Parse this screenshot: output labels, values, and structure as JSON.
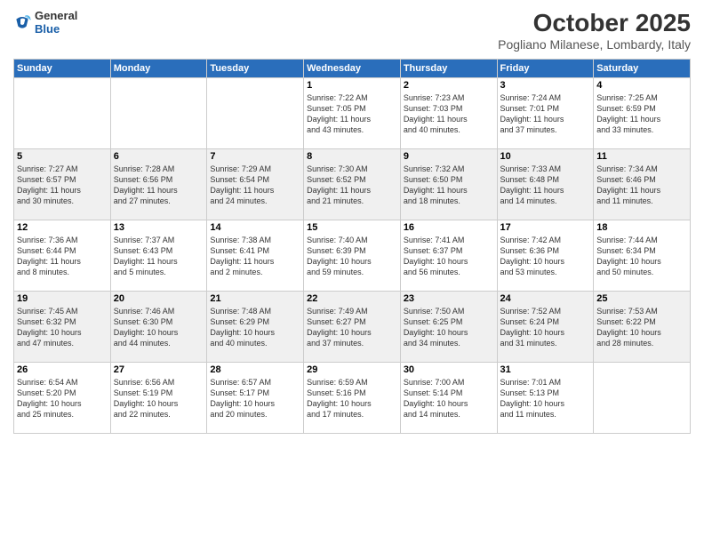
{
  "header": {
    "logo_general": "General",
    "logo_blue": "Blue",
    "month_title": "October 2025",
    "location": "Pogliano Milanese, Lombardy, Italy"
  },
  "weekdays": [
    "Sunday",
    "Monday",
    "Tuesday",
    "Wednesday",
    "Thursday",
    "Friday",
    "Saturday"
  ],
  "rows": [
    {
      "shade": "white",
      "cells": [
        {
          "day": "",
          "info": ""
        },
        {
          "day": "",
          "info": ""
        },
        {
          "day": "",
          "info": ""
        },
        {
          "day": "1",
          "info": "Sunrise: 7:22 AM\nSunset: 7:05 PM\nDaylight: 11 hours\nand 43 minutes."
        },
        {
          "day": "2",
          "info": "Sunrise: 7:23 AM\nSunset: 7:03 PM\nDaylight: 11 hours\nand 40 minutes."
        },
        {
          "day": "3",
          "info": "Sunrise: 7:24 AM\nSunset: 7:01 PM\nDaylight: 11 hours\nand 37 minutes."
        },
        {
          "day": "4",
          "info": "Sunrise: 7:25 AM\nSunset: 6:59 PM\nDaylight: 11 hours\nand 33 minutes."
        }
      ]
    },
    {
      "shade": "shaded",
      "cells": [
        {
          "day": "5",
          "info": "Sunrise: 7:27 AM\nSunset: 6:57 PM\nDaylight: 11 hours\nand 30 minutes."
        },
        {
          "day": "6",
          "info": "Sunrise: 7:28 AM\nSunset: 6:56 PM\nDaylight: 11 hours\nand 27 minutes."
        },
        {
          "day": "7",
          "info": "Sunrise: 7:29 AM\nSunset: 6:54 PM\nDaylight: 11 hours\nand 24 minutes."
        },
        {
          "day": "8",
          "info": "Sunrise: 7:30 AM\nSunset: 6:52 PM\nDaylight: 11 hours\nand 21 minutes."
        },
        {
          "day": "9",
          "info": "Sunrise: 7:32 AM\nSunset: 6:50 PM\nDaylight: 11 hours\nand 18 minutes."
        },
        {
          "day": "10",
          "info": "Sunrise: 7:33 AM\nSunset: 6:48 PM\nDaylight: 11 hours\nand 14 minutes."
        },
        {
          "day": "11",
          "info": "Sunrise: 7:34 AM\nSunset: 6:46 PM\nDaylight: 11 hours\nand 11 minutes."
        }
      ]
    },
    {
      "shade": "white",
      "cells": [
        {
          "day": "12",
          "info": "Sunrise: 7:36 AM\nSunset: 6:44 PM\nDaylight: 11 hours\nand 8 minutes."
        },
        {
          "day": "13",
          "info": "Sunrise: 7:37 AM\nSunset: 6:43 PM\nDaylight: 11 hours\nand 5 minutes."
        },
        {
          "day": "14",
          "info": "Sunrise: 7:38 AM\nSunset: 6:41 PM\nDaylight: 11 hours\nand 2 minutes."
        },
        {
          "day": "15",
          "info": "Sunrise: 7:40 AM\nSunset: 6:39 PM\nDaylight: 10 hours\nand 59 minutes."
        },
        {
          "day": "16",
          "info": "Sunrise: 7:41 AM\nSunset: 6:37 PM\nDaylight: 10 hours\nand 56 minutes."
        },
        {
          "day": "17",
          "info": "Sunrise: 7:42 AM\nSunset: 6:36 PM\nDaylight: 10 hours\nand 53 minutes."
        },
        {
          "day": "18",
          "info": "Sunrise: 7:44 AM\nSunset: 6:34 PM\nDaylight: 10 hours\nand 50 minutes."
        }
      ]
    },
    {
      "shade": "shaded",
      "cells": [
        {
          "day": "19",
          "info": "Sunrise: 7:45 AM\nSunset: 6:32 PM\nDaylight: 10 hours\nand 47 minutes."
        },
        {
          "day": "20",
          "info": "Sunrise: 7:46 AM\nSunset: 6:30 PM\nDaylight: 10 hours\nand 44 minutes."
        },
        {
          "day": "21",
          "info": "Sunrise: 7:48 AM\nSunset: 6:29 PM\nDaylight: 10 hours\nand 40 minutes."
        },
        {
          "day": "22",
          "info": "Sunrise: 7:49 AM\nSunset: 6:27 PM\nDaylight: 10 hours\nand 37 minutes."
        },
        {
          "day": "23",
          "info": "Sunrise: 7:50 AM\nSunset: 6:25 PM\nDaylight: 10 hours\nand 34 minutes."
        },
        {
          "day": "24",
          "info": "Sunrise: 7:52 AM\nSunset: 6:24 PM\nDaylight: 10 hours\nand 31 minutes."
        },
        {
          "day": "25",
          "info": "Sunrise: 7:53 AM\nSunset: 6:22 PM\nDaylight: 10 hours\nand 28 minutes."
        }
      ]
    },
    {
      "shade": "white",
      "cells": [
        {
          "day": "26",
          "info": "Sunrise: 6:54 AM\nSunset: 5:20 PM\nDaylight: 10 hours\nand 25 minutes."
        },
        {
          "day": "27",
          "info": "Sunrise: 6:56 AM\nSunset: 5:19 PM\nDaylight: 10 hours\nand 22 minutes."
        },
        {
          "day": "28",
          "info": "Sunrise: 6:57 AM\nSunset: 5:17 PM\nDaylight: 10 hours\nand 20 minutes."
        },
        {
          "day": "29",
          "info": "Sunrise: 6:59 AM\nSunset: 5:16 PM\nDaylight: 10 hours\nand 17 minutes."
        },
        {
          "day": "30",
          "info": "Sunrise: 7:00 AM\nSunset: 5:14 PM\nDaylight: 10 hours\nand 14 minutes."
        },
        {
          "day": "31",
          "info": "Sunrise: 7:01 AM\nSunset: 5:13 PM\nDaylight: 10 hours\nand 11 minutes."
        },
        {
          "day": "",
          "info": ""
        }
      ]
    }
  ]
}
